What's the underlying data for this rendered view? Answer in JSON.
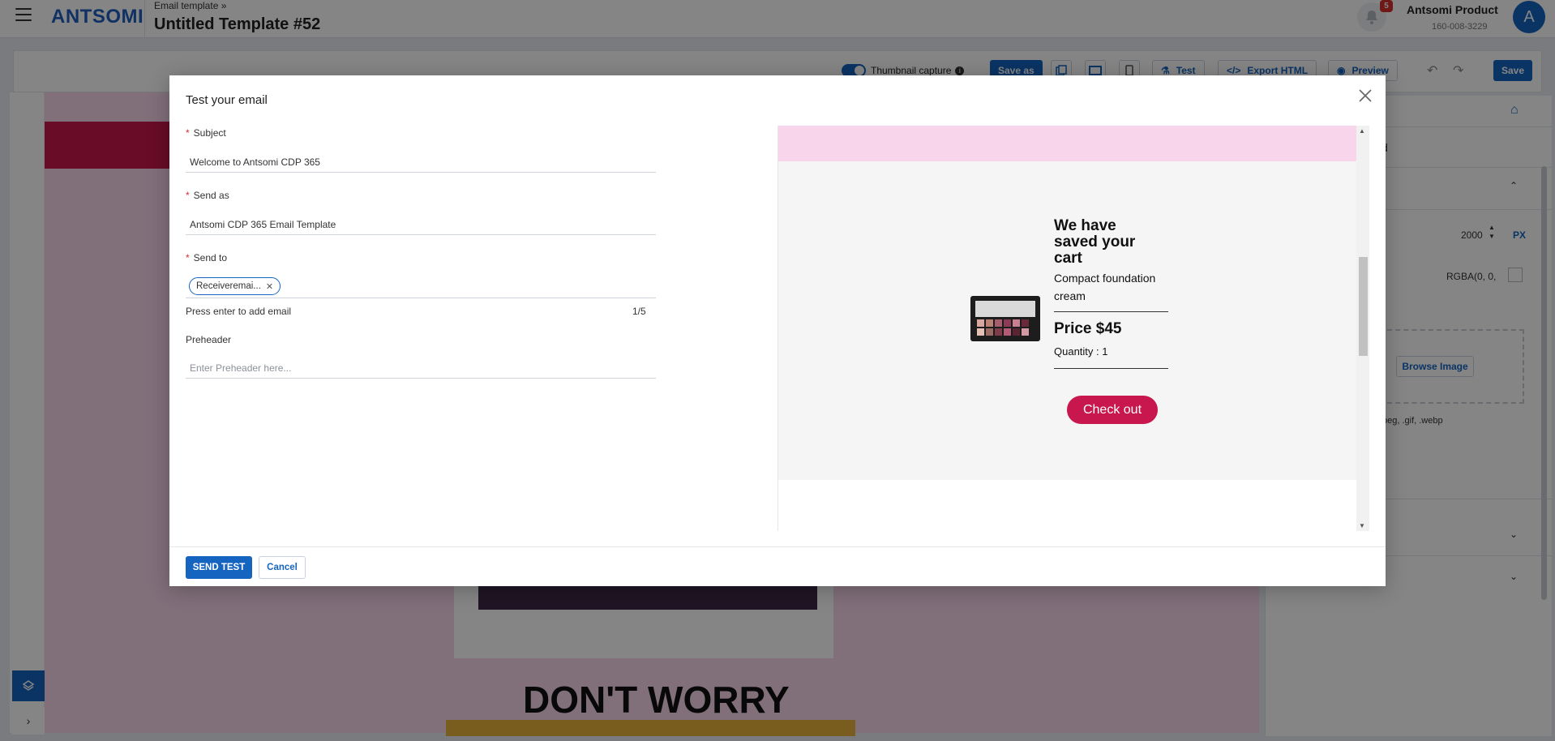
{
  "header": {
    "breadcrumb": "Email template »",
    "title": "Untitled Template #52",
    "logo": "ANTSOMI",
    "notifications_count": "5",
    "account_name": "Antsomi Product",
    "account_id": "160-008-3229",
    "avatar_letter": "A"
  },
  "toolbar": {
    "thumbnail_label": "Thumbnail capture",
    "save_as_label": "Save as",
    "test_label": "Test",
    "export_label": "Export HTML",
    "preview_label": "Preview",
    "save_label": "Save"
  },
  "canvas": {
    "headline": "DON'T WORRY"
  },
  "right_panel": {
    "tab_partial": "d",
    "width_value": "2000",
    "width_unit": "PX",
    "color_value": "RGBA(0, 0,",
    "browse_label": "Browse Image",
    "formats": "peg, .gif, .webp"
  },
  "modal": {
    "title": "Test your email",
    "subject_label": "Subject",
    "subject_value": "Welcome to Antsomi CDP 365",
    "send_as_label": "Send as",
    "send_as_value": "Antsomi CDP 365 Email Template",
    "send_to_label": "Send to",
    "recipient_chip": "Receiveremai...",
    "hint": "Press enter to add email",
    "counter": "1/5",
    "preheader_label": "Preheader",
    "preheader_placeholder": "Enter Preheader here...",
    "send_button": "SEND TEST",
    "cancel_button": "Cancel"
  },
  "preview": {
    "headline": "We have saved your cart",
    "product": "Compact foundation cream",
    "price": "Price $45",
    "quantity": "Quantity : 1",
    "checkout": "Check out"
  },
  "colors": {
    "primary": "#1565c0",
    "accent": "#c8174e",
    "pink_bg": "#f8d5ea"
  }
}
